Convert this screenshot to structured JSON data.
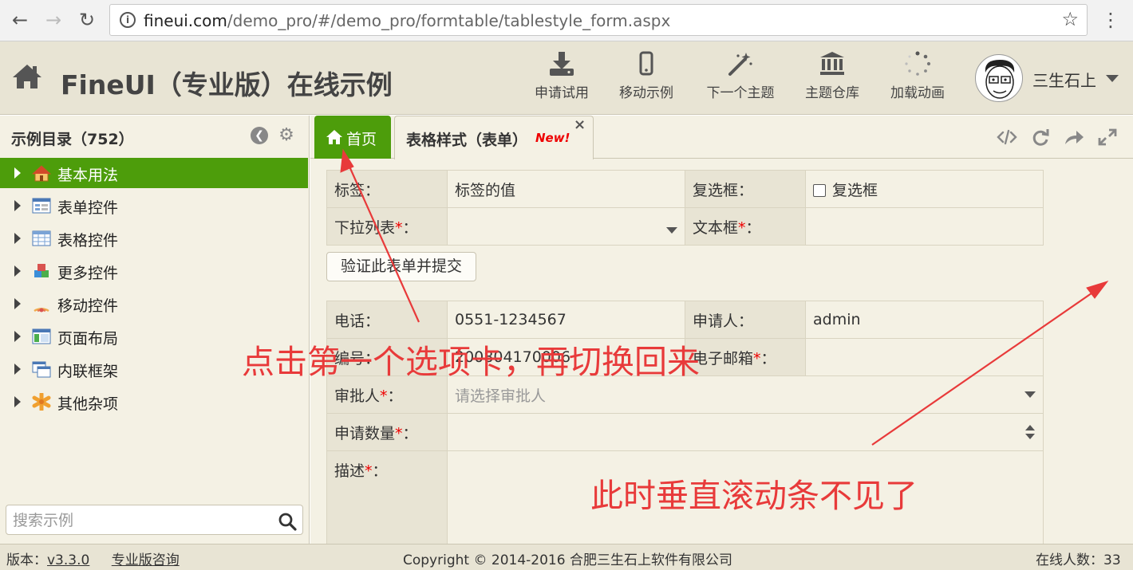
{
  "browser": {
    "url_host": "fineui.com",
    "url_path": "/demo_pro/#/demo_pro/formtable/tablestyle_form.aspx"
  },
  "header": {
    "title": "FineUI（专业版）在线示例",
    "buttons": [
      {
        "label": "申请试用",
        "icon": "download-icon"
      },
      {
        "label": "移动示例",
        "icon": "mobile-icon"
      },
      {
        "label": "下一个主题",
        "icon": "magic-wand-icon"
      },
      {
        "label": "主题仓库",
        "icon": "bank-icon"
      },
      {
        "label": "加载动画",
        "icon": "spinner-icon"
      }
    ],
    "username": "三生石上"
  },
  "sidebar": {
    "title": "示例目录（752）",
    "items": [
      {
        "label": "基本用法",
        "icon": "home-icon",
        "selected": true
      },
      {
        "label": "表单控件",
        "icon": "form-icon",
        "selected": false
      },
      {
        "label": "表格控件",
        "icon": "table-icon",
        "selected": false
      },
      {
        "label": "更多控件",
        "icon": "cubes-icon",
        "selected": false
      },
      {
        "label": "移动控件",
        "icon": "feed-icon",
        "selected": false
      },
      {
        "label": "页面布局",
        "icon": "layout-icon",
        "selected": false
      },
      {
        "label": "内联框架",
        "icon": "window-icon",
        "selected": false
      },
      {
        "label": "其他杂项",
        "icon": "asterisk-icon",
        "selected": false
      }
    ],
    "search_placeholder": "搜索示例"
  },
  "tabs": {
    "home_label": "首页",
    "form_label": "表格样式（表单）",
    "new_badge": "New!",
    "close": "×"
  },
  "form1": {
    "label_label": "标签：",
    "label_value": "标签的值",
    "checkbox_label": "复选框：",
    "checkbox_text": "复选框",
    "dropdown_label": "下拉列表",
    "textbox_label": "文本框",
    "colon": "：",
    "required_mark": "*",
    "submit": "验证此表单并提交"
  },
  "form2": {
    "phone_label": "电话：",
    "phone_value": "0551-1234567",
    "applicant_label": "申请人：",
    "applicant_value": "admin",
    "number_label": "编号：",
    "number_value": "200804170006",
    "email_label": "电子邮箱",
    "approver_label": "审批人",
    "approver_placeholder": "请选择审批人",
    "quantity_label": "申请数量",
    "desc_label": "描述"
  },
  "footer": {
    "version_prefix": "版本：",
    "version": "v3.3.0",
    "consult": "专业版咨询",
    "copyright": "Copyright © 2014-2016 合肥三生石上软件有限公司",
    "online": "在线人数：33"
  },
  "annotations": {
    "note1": "点击第一个选项卡，再切换回来",
    "note2": "此时垂直滚动条不见了",
    "color": "#e83a3a"
  }
}
